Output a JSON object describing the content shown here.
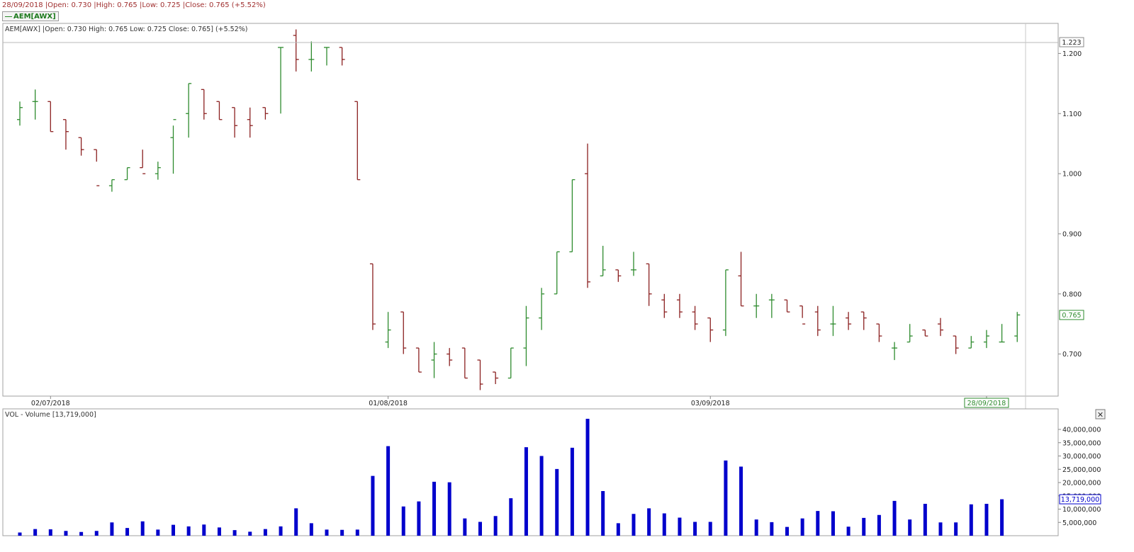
{
  "header": {
    "info_text": "28/09/2018 |Open: 0.730 |High: 0.765 |Low: 0.725 |Close: 0.765 (+5.52%)",
    "legend_button_label": "AEM[AWX]"
  },
  "price_panel": {
    "title": "AEM[AWX] |Open: 0.730  High: 0.765  Low: 0.725  Close: 0.765] (+5.52%)",
    "crosshair_value": "1.223",
    "last_value_label": "0.765",
    "x_date_labels": [
      {
        "label": "02/07/2018",
        "index": 2
      },
      {
        "label": "01/08/2018",
        "index": 24
      },
      {
        "label": "03/09/2018",
        "index": 45
      },
      {
        "label": "28/09/2018",
        "index": 63
      }
    ]
  },
  "volume_panel": {
    "title": "VOL - Volume [13,719,000]",
    "last_value_label": "13,719,000",
    "close_label": "✕"
  },
  "colors": {
    "up": "#2e8b2e",
    "down": "#8b2020",
    "volume": "#0000cc",
    "header_text": "#a03030"
  },
  "chart_data": [
    {
      "type": "ohlc",
      "title": "AEM[AWX]",
      "y_ticks": [
        "0.700",
        "0.800",
        "0.900",
        "1.000",
        "1.100",
        "1.200"
      ],
      "ylim": [
        0.63,
        1.25
      ],
      "x": [
        "27/06/2018",
        "28/06/2018",
        "29/06/2018",
        "02/07/2018",
        "03/07/2018",
        "04/07/2018",
        "05/07/2018",
        "06/07/2018",
        "09/07/2018",
        "10/07/2018",
        "11/07/2018",
        "12/07/2018",
        "13/07/2018",
        "16/07/2018",
        "17/07/2018",
        "18/07/2018",
        "19/07/2018",
        "20/07/2018",
        "23/07/2018",
        "24/07/2018",
        "25/07/2018",
        "26/07/2018",
        "27/07/2018",
        "30/07/2018",
        "31/07/2018",
        "01/08/2018",
        "02/08/2018",
        "03/08/2018",
        "06/08/2018",
        "07/08/2018",
        "08/08/2018",
        "10/08/2018",
        "13/08/2018",
        "14/08/2018",
        "15/08/2018",
        "16/08/2018",
        "17/08/2018",
        "20/08/2018",
        "21/08/2018",
        "23/08/2018",
        "24/08/2018",
        "27/08/2018",
        "28/08/2018",
        "29/08/2018",
        "30/08/2018",
        "31/08/2018",
        "03/09/2018",
        "04/09/2018",
        "05/09/2018",
        "06/09/2018",
        "07/09/2018",
        "10/09/2018",
        "11/09/2018",
        "12/09/2018",
        "13/09/2018",
        "14/09/2018",
        "17/09/2018",
        "18/09/2018",
        "19/09/2018",
        "20/09/2018",
        "21/09/2018",
        "24/09/2018",
        "25/09/2018",
        "26/09/2018",
        "27/09/2018",
        "28/09/2018"
      ],
      "open": [
        1.09,
        1.12,
        1.12,
        1.09,
        1.06,
        1.04,
        0.98,
        0.99,
        1.01,
        1.0,
        1.06,
        1.1,
        1.14,
        1.12,
        1.11,
        1.09,
        1.11,
        1.21,
        1.23,
        1.19,
        1.21,
        1.21,
        1.12,
        0.85,
        0.72,
        0.77,
        0.71,
        0.69,
        0.7,
        0.71,
        0.69,
        0.67,
        0.66,
        0.71,
        0.76,
        0.8,
        0.87,
        1.0,
        0.83,
        0.84,
        0.84,
        0.85,
        0.79,
        0.79,
        0.77,
        0.76,
        0.74,
        0.83,
        0.78,
        0.79,
        0.79,
        0.78,
        0.77,
        0.75,
        0.76,
        0.77,
        0.75,
        0.71,
        0.72,
        0.74,
        0.75,
        0.73,
        0.71,
        0.72,
        0.72,
        0.73
      ],
      "high": [
        1.12,
        1.14,
        1.12,
        1.09,
        1.06,
        1.04,
        0.99,
        1.01,
        1.04,
        1.02,
        1.08,
        1.15,
        1.14,
        1.12,
        1.11,
        1.11,
        1.11,
        1.21,
        1.24,
        1.22,
        1.21,
        1.21,
        1.12,
        0.85,
        0.77,
        0.77,
        0.71,
        0.72,
        0.71,
        0.71,
        0.69,
        0.67,
        0.71,
        0.78,
        0.81,
        0.87,
        0.99,
        1.05,
        0.88,
        0.84,
        0.87,
        0.85,
        0.8,
        0.8,
        0.78,
        0.76,
        0.84,
        0.87,
        0.8,
        0.8,
        0.79,
        0.78,
        0.78,
        0.78,
        0.77,
        0.77,
        0.75,
        0.72,
        0.75,
        0.74,
        0.76,
        0.73,
        0.73,
        0.74,
        0.75,
        0.77
      ],
      "low": [
        1.08,
        1.09,
        1.07,
        1.04,
        1.03,
        1.02,
        0.97,
        0.99,
        1.01,
        0.99,
        1.0,
        1.06,
        1.09,
        1.09,
        1.06,
        1.06,
        1.09,
        1.1,
        1.17,
        1.17,
        1.18,
        1.18,
        0.99,
        0.74,
        0.71,
        0.7,
        0.67,
        0.66,
        0.68,
        0.66,
        0.64,
        0.65,
        0.66,
        0.68,
        0.74,
        0.8,
        0.87,
        0.81,
        0.83,
        0.82,
        0.83,
        0.78,
        0.76,
        0.76,
        0.74,
        0.72,
        0.73,
        0.78,
        0.76,
        0.76,
        0.77,
        0.76,
        0.73,
        0.73,
        0.74,
        0.74,
        0.72,
        0.69,
        0.72,
        0.73,
        0.73,
        0.7,
        0.71,
        0.71,
        0.72,
        0.72
      ],
      "close": [
        1.11,
        1.12,
        1.07,
        1.07,
        1.04,
        0.98,
        0.99,
        1.01,
        1.0,
        1.01,
        1.09,
        1.15,
        1.1,
        1.09,
        1.08,
        1.08,
        1.1,
        1.21,
        1.19,
        1.19,
        1.21,
        1.19,
        0.99,
        0.75,
        0.74,
        0.71,
        0.67,
        0.7,
        0.69,
        0.66,
        0.65,
        0.66,
        0.71,
        0.76,
        0.8,
        0.87,
        0.99,
        0.82,
        0.84,
        0.83,
        0.84,
        0.8,
        0.77,
        0.77,
        0.75,
        0.74,
        0.84,
        0.78,
        0.78,
        0.79,
        0.77,
        0.75,
        0.74,
        0.75,
        0.75,
        0.76,
        0.73,
        0.71,
        0.73,
        0.73,
        0.74,
        0.71,
        0.72,
        0.73,
        0.72,
        0.765
      ]
    },
    {
      "type": "bar",
      "title": "VOL - Volume [13,719,000]",
      "y_ticks": [
        "5,000,000",
        "10,000,000",
        "15,000,000",
        "20,000,000",
        "25,000,000",
        "30,000,000",
        "35,000,000",
        "40,000,000"
      ],
      "ylim": [
        0,
        44000000
      ],
      "values": [
        1200000,
        2500000,
        2400000,
        1800000,
        1400000,
        1800000,
        5000000,
        2900000,
        5400000,
        2300000,
        4100000,
        3500000,
        4200000,
        3100000,
        2100000,
        1500000,
        2500000,
        3500000,
        10300000,
        4700000,
        2300000,
        2200000,
        2300000,
        22500000,
        33700000,
        11000000,
        12900000,
        20300000,
        20100000,
        6500000,
        5200000,
        7400000,
        14100000,
        33300000,
        30000000,
        25100000,
        33100000,
        44000000,
        16800000,
        4700000,
        8200000,
        10300000,
        8400000,
        6800000,
        5200000,
        5200000,
        28300000,
        26000000,
        6100000,
        5100000,
        3300000,
        6500000,
        9300000,
        9200000,
        3400000,
        6700000,
        7800000,
        13100000,
        6100000,
        12000000,
        5000000,
        5000000,
        11800000,
        12000000,
        13719000
      ]
    }
  ]
}
